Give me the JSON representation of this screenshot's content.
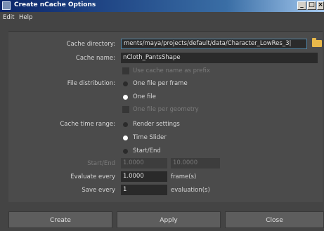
{
  "window": {
    "title": "Create nCache Options"
  },
  "menu": [
    "Edit",
    "Help"
  ],
  "form": {
    "cache_directory_label": "Cache directory:",
    "cache_directory_value": "ments/maya/projects/default/data/Character_LowRes_3|",
    "cache_name_label": "Cache name:",
    "cache_name_value": "nCloth_PantsShape",
    "use_prefix_label": "Use cache name as prefix",
    "file_distribution_label": "File distribution:",
    "file_distribution_options": [
      "One file per frame",
      "One file"
    ],
    "file_distribution_selected": "One file",
    "one_file_per_geometry_label": "One file per geometry",
    "cache_time_range_label": "Cache time range:",
    "cache_time_range_options": [
      "Render settings",
      "Time Slider",
      "Start/End"
    ],
    "cache_time_range_selected": "Time Slider",
    "start_end_label": "Start/End",
    "start_value": "1.0000",
    "end_value": "10.0000",
    "evaluate_every_label": "Evaluate every",
    "evaluate_every_value": "1.0000",
    "evaluate_every_unit": "frame(s)",
    "save_every_label": "Save every",
    "save_every_value": "1",
    "save_every_unit": "evaluation(s)"
  },
  "buttons": {
    "create": "Create",
    "apply": "Apply",
    "close": "Close"
  }
}
